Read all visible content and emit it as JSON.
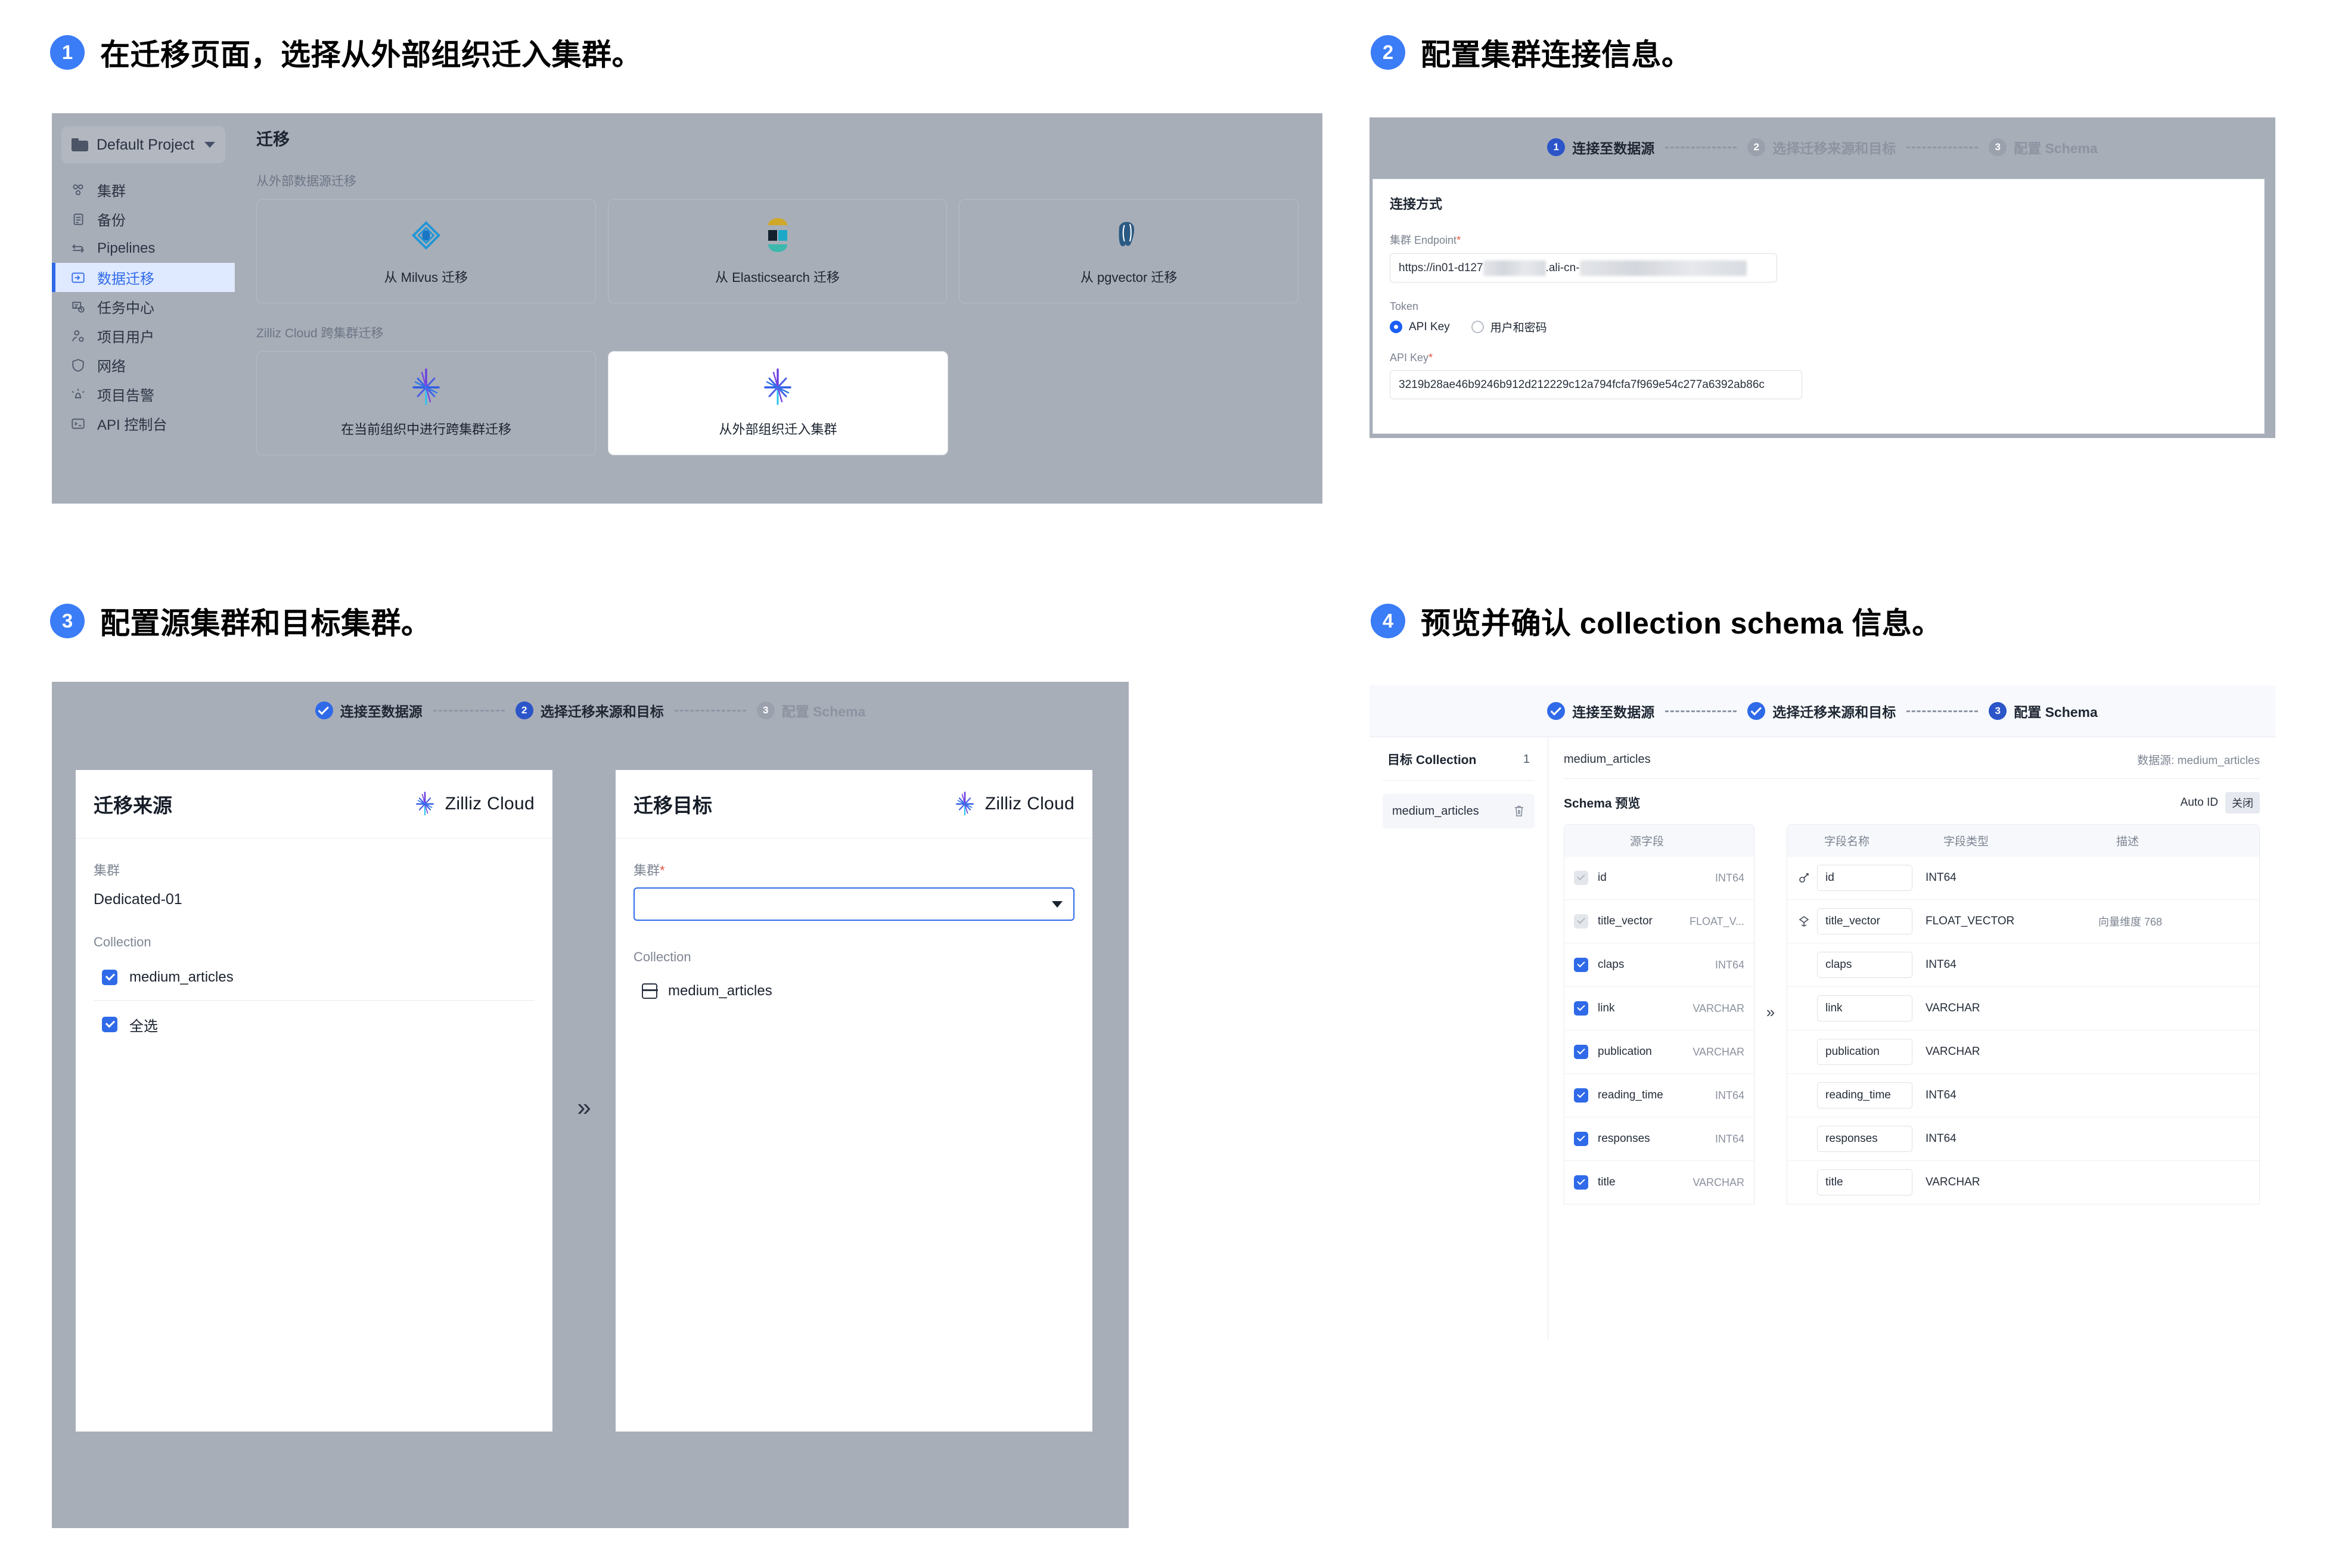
{
  "steps": [
    {
      "num": "1",
      "text_prefix": "在",
      "text_bold1": "迁移",
      "text_mid": "页面，选择",
      "text_bold2": "从外部组织迁入集群",
      "text_suffix": "。",
      "full": "在迁移页面，选择从外部组织迁入集群。"
    },
    {
      "num": "2",
      "full": "配置集群连接信息。"
    },
    {
      "num": "3",
      "full": "配置源集群和目标集群。"
    },
    {
      "num": "4",
      "full": "预览并确认 collection schema 信息。"
    }
  ],
  "panel1": {
    "project_selector": {
      "label": "Default Project",
      "icon": "folder-icon",
      "caret": "chevron-down-icon"
    },
    "nav": [
      {
        "label": "集群",
        "icon": "cluster-icon",
        "active": false
      },
      {
        "label": "备份",
        "icon": "backup-icon",
        "active": false
      },
      {
        "label": "Pipelines",
        "icon": "pipelines-icon",
        "active": false
      },
      {
        "label": "数据迁移",
        "icon": "migration-icon",
        "active": true
      },
      {
        "label": "任务中心",
        "icon": "task-center-icon",
        "active": false
      },
      {
        "label": "项目用户",
        "icon": "project-users-icon",
        "active": false
      },
      {
        "label": "网络",
        "icon": "network-shield-icon",
        "active": false
      },
      {
        "label": "项目告警",
        "icon": "alert-icon",
        "active": false
      },
      {
        "label": "API 控制台",
        "icon": "api-console-icon",
        "active": false
      }
    ],
    "title": "迁移",
    "section_external": "从外部数据源迁移",
    "external_cards": [
      {
        "label": "从 Milvus 迁移",
        "icon": "milvus-logo"
      },
      {
        "label": "从 Elasticsearch 迁移",
        "icon": "elasticsearch-logo"
      },
      {
        "label": "从 pgvector 迁移",
        "icon": "pgvector-logo"
      }
    ],
    "section_cross": "Zilliz Cloud 跨集群迁移",
    "cross_cards": [
      {
        "label": "在当前组织中进行跨集群迁移",
        "icon": "zilliz-logo",
        "selected": false
      },
      {
        "label": "从外部组织迁入集群",
        "icon": "zilliz-logo",
        "selected": true
      }
    ]
  },
  "stepper_labels": {
    "s1": "连接至数据源",
    "s2": "选择迁移来源和目标",
    "s3": "配置 Schema"
  },
  "panel2": {
    "stepper_state": [
      "current",
      "todo",
      "todo"
    ],
    "heading": "连接方式",
    "endpoint_label": "集群 Endpoint",
    "endpoint_required": "*",
    "endpoint_value_visible": "https://in01-d127",
    "endpoint_value_mid": ".ali-cn-",
    "token_label": "Token",
    "token_options": [
      {
        "label": "API Key",
        "selected": true
      },
      {
        "label": "用户和密码",
        "selected": false
      }
    ],
    "apikey_label": "API Key",
    "apikey_required": "*",
    "apikey_value": "3219b28ae46b9246b912d212229c12a794fcfa7f969e54c277a6392ab86c"
  },
  "panel3": {
    "stepper_state": [
      "done",
      "current",
      "todo"
    ],
    "source": {
      "title": "迁移来源",
      "brand": "Zilliz Cloud",
      "cluster_label": "集群",
      "cluster_value": "Dedicated-01",
      "collection_label": "Collection",
      "collections": [
        {
          "name": "medium_articles",
          "checked": true
        }
      ],
      "select_all_label": "全选",
      "select_all_checked": true
    },
    "arrow": "»",
    "target": {
      "title": "迁移目标",
      "brand": "Zilliz Cloud",
      "cluster_label": "集群",
      "cluster_required": "*",
      "cluster_value": "",
      "collection_label": "Collection",
      "collections": [
        {
          "name": "medium_articles",
          "icon": "collection-icon"
        }
      ]
    }
  },
  "panel4": {
    "stepper_state": [
      "done",
      "done",
      "current"
    ],
    "left": {
      "header_label": "目标 Collection",
      "header_count": "1",
      "items": [
        {
          "name": "medium_articles",
          "delete_icon": "trash-icon"
        }
      ]
    },
    "right": {
      "collection_name": "medium_articles",
      "datasource_text": "数据源: medium_articles",
      "schema_preview_label": "Schema 预览",
      "auto_id_label": "Auto ID",
      "auto_id_value": "关闭",
      "source_col_header": "源字段",
      "target_headers": [
        "字段名称",
        "字段类型",
        "描述"
      ],
      "rows": [
        {
          "src_name": "id",
          "src_type": "INT64",
          "checked": true,
          "disabled": true,
          "dst_name": "id",
          "dst_type": "INT64",
          "desc": "",
          "icon": "primary-key-icon"
        },
        {
          "src_name": "title_vector",
          "src_type": "FLOAT_V...",
          "checked": true,
          "disabled": true,
          "dst_name": "title_vector",
          "dst_type": "FLOAT_VECTOR",
          "desc": "向量维度 768",
          "icon": "vector-icon"
        },
        {
          "src_name": "claps",
          "src_type": "INT64",
          "checked": true,
          "disabled": false,
          "dst_name": "claps",
          "dst_type": "INT64",
          "desc": "",
          "icon": ""
        },
        {
          "src_name": "link",
          "src_type": "VARCHAR",
          "checked": true,
          "disabled": false,
          "dst_name": "link",
          "dst_type": "VARCHAR",
          "desc": "",
          "icon": ""
        },
        {
          "src_name": "publication",
          "src_type": "VARCHAR",
          "checked": true,
          "disabled": false,
          "dst_name": "publication",
          "dst_type": "VARCHAR",
          "desc": "",
          "icon": ""
        },
        {
          "src_name": "reading_time",
          "src_type": "INT64",
          "checked": true,
          "disabled": false,
          "dst_name": "reading_time",
          "dst_type": "INT64",
          "desc": "",
          "icon": ""
        },
        {
          "src_name": "responses",
          "src_type": "INT64",
          "checked": true,
          "disabled": false,
          "dst_name": "responses",
          "dst_type": "INT64",
          "desc": "",
          "icon": ""
        },
        {
          "src_name": "title",
          "src_type": "VARCHAR",
          "checked": true,
          "disabled": false,
          "dst_name": "title",
          "dst_type": "VARCHAR",
          "desc": "",
          "icon": ""
        }
      ],
      "arrow": "»"
    }
  },
  "colors": {
    "accent": "#2f6ae8",
    "accent_dark": "#2b55c8",
    "panel_bg": "#a8aeb8",
    "required": "#e8553d"
  }
}
